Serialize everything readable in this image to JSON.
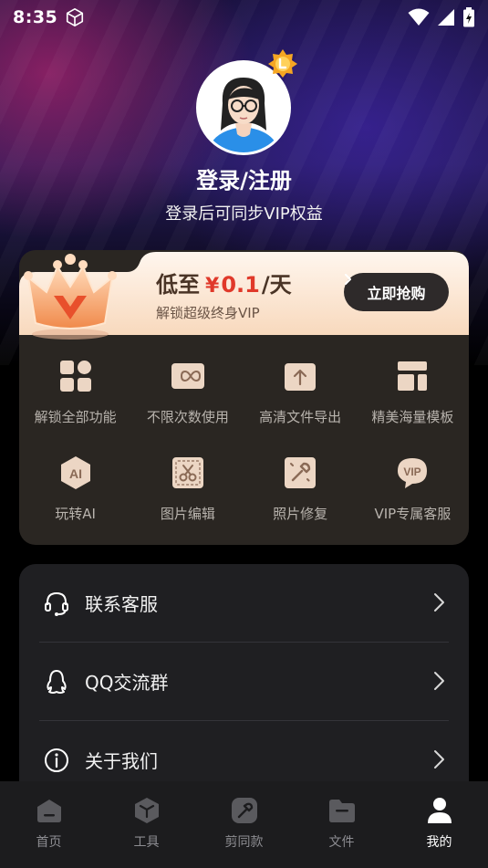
{
  "status_bar": {
    "time": "8:35"
  },
  "profile": {
    "title": "登录/注册",
    "subtitle": "登录后可同步VIP权益"
  },
  "vip": {
    "price_prefix": "低至",
    "price_currency": "¥",
    "price_value": "0.1",
    "price_unit": "/天",
    "subtitle": "解锁超级终身VIP",
    "buy_label": "立即抢购",
    "features": [
      {
        "label": "解锁全部功能",
        "icon": "grid-icon"
      },
      {
        "label": "不限次数使用",
        "icon": "infinity-icon"
      },
      {
        "label": "高清文件导出",
        "icon": "export-icon"
      },
      {
        "label": "精美海量模板",
        "icon": "template-icon"
      },
      {
        "label": "玩转AI",
        "icon": "ai-icon"
      },
      {
        "label": "图片编辑",
        "icon": "scissors-icon"
      },
      {
        "label": "照片修复",
        "icon": "repair-icon"
      },
      {
        "label": "VIP专属客服",
        "icon": "vip-icon"
      }
    ]
  },
  "menu": {
    "items": [
      {
        "label": "联系客服",
        "icon": "headset-icon"
      },
      {
        "label": "QQ交流群",
        "icon": "qq-icon"
      },
      {
        "label": "关于我们",
        "icon": "info-icon"
      }
    ]
  },
  "tabbar": {
    "tabs": [
      {
        "label": "首页",
        "icon": "home-icon"
      },
      {
        "label": "工具",
        "icon": "tools-icon"
      },
      {
        "label": "剪同款",
        "icon": "template-cut-icon"
      },
      {
        "label": "文件",
        "icon": "folder-icon"
      },
      {
        "label": "我的",
        "icon": "profile-icon",
        "active": true
      }
    ]
  },
  "colors": {
    "accent_price": "#e0392a",
    "card_bg": "#2a2622",
    "menu_bg": "#1f1f22",
    "tabbar_bg": "#1c1c1e"
  }
}
